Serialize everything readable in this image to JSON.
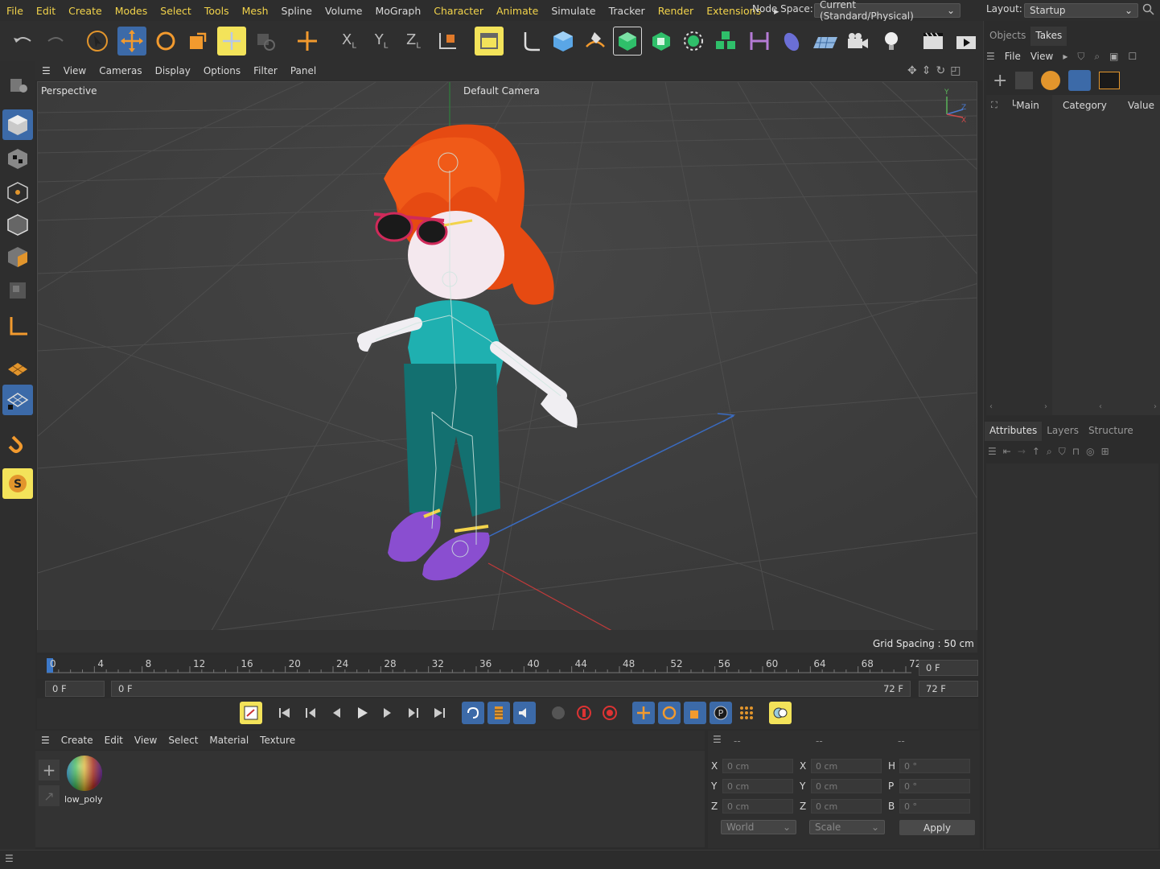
{
  "menubar": {
    "items": [
      "File",
      "Edit",
      "Create",
      "Modes",
      "Select",
      "Tools",
      "Mesh",
      "Spline",
      "Volume",
      "MoGraph",
      "Character",
      "Animate",
      "Simulate",
      "Tracker",
      "Render",
      "Extensions"
    ],
    "highlight": [
      "File",
      "Edit",
      "Create",
      "Modes",
      "Select",
      "Tools",
      "Mesh",
      "Character",
      "Animate",
      "Render",
      "Extensions"
    ],
    "node_space_label": "Node Space:",
    "node_space_value": "Current (Standard/Physical)",
    "layout_label": "Layout:",
    "layout_value": "Startup"
  },
  "viewport": {
    "menu": [
      "View",
      "Cameras",
      "Display",
      "Options",
      "Filter",
      "Panel"
    ],
    "highlight": [
      "Options",
      "Filter"
    ],
    "label": "Perspective",
    "camera": "Default Camera",
    "grid_spacing": "Grid Spacing : 50 cm"
  },
  "timeline": {
    "ticks": [
      "0",
      "4",
      "8",
      "12",
      "16",
      "20",
      "24",
      "28",
      "32",
      "36",
      "40",
      "44",
      "48",
      "52",
      "56",
      "60",
      "64",
      "68",
      "72"
    ],
    "current_frame": "0 F",
    "start": "0 F",
    "range_start": "0 F",
    "range_end": "72 F",
    "end": "72 F"
  },
  "material_manager": {
    "menu": [
      "Create",
      "Edit",
      "View",
      "Select",
      "Material",
      "Texture"
    ],
    "highlight": [
      "Edit"
    ],
    "materials": [
      {
        "name": "low_poly"
      }
    ]
  },
  "coordinates": {
    "headers": [
      "--",
      "--",
      "--"
    ],
    "rows": [
      {
        "a": "X",
        "av": "0 cm",
        "b": "X",
        "bv": "0 cm",
        "c": "H",
        "cv": "0 °"
      },
      {
        "a": "Y",
        "av": "0 cm",
        "b": "Y",
        "bv": "0 cm",
        "c": "P",
        "cv": "0 °"
      },
      {
        "a": "Z",
        "av": "0 cm",
        "b": "Z",
        "bv": "0 cm",
        "c": "B",
        "cv": "0 °"
      }
    ],
    "space": "World",
    "mode": "Scale",
    "apply": "Apply"
  },
  "objects_panel": {
    "tabs": [
      "Objects",
      "Takes"
    ],
    "menu": [
      "File",
      "View"
    ],
    "tree_item": "Main",
    "columns": [
      "Category",
      "Value"
    ]
  },
  "attributes_panel": {
    "tabs": [
      "Attributes",
      "Layers",
      "Structure"
    ]
  },
  "colors": {
    "accent_yellow": "#f2d34b",
    "selected_blue": "#3c6aa8",
    "viewport_bg": "#393939"
  }
}
